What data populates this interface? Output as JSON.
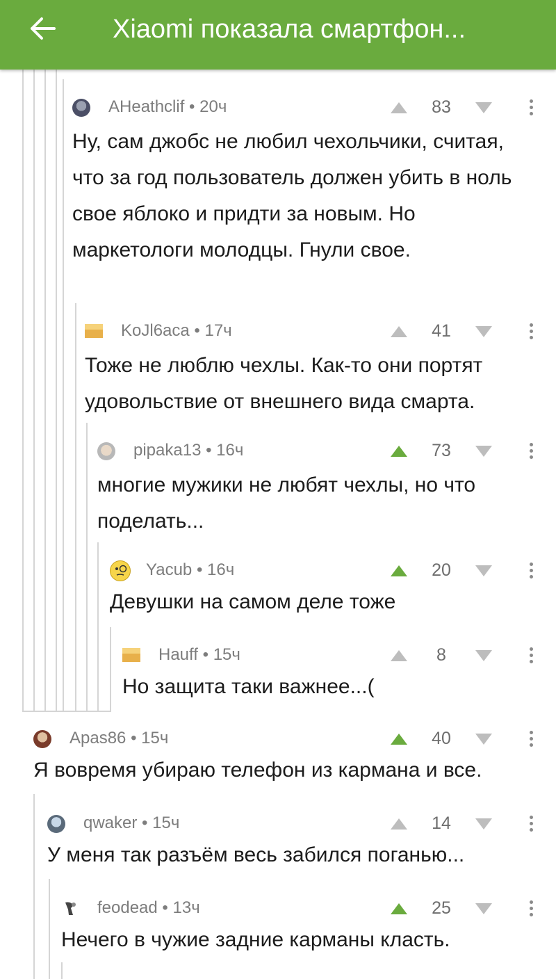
{
  "header": {
    "title": "Xiaomi показала смартфон...",
    "back_icon": "arrow-left-icon",
    "background_color": "#6aab3e"
  },
  "comments": [
    {
      "author": "AHeathclif",
      "time": "20ч",
      "rating": "83",
      "upvoted": false,
      "avatar": "avatar-photo",
      "text": "Ну, сам джобс не любил чехольчики, считая, что за год пользователь должен убить в ноль свое яблоко и придти за новым. Но маркетологи молодцы. Гнули свое."
    },
    {
      "author": "KoJl6aca",
      "time": "17ч",
      "rating": "41",
      "upvoted": false,
      "avatar": "default-avatar",
      "text": "Тоже не люблю чехлы. Как-то они портят удовольствие от внешнего вида смарта."
    },
    {
      "author": "pipaka13",
      "time": "16ч",
      "rating": "73",
      "upvoted": true,
      "avatar": "avatar-photo",
      "text": "многие мужики не любят чехлы, но что поделать..."
    },
    {
      "author": "Yacub",
      "time": "16ч",
      "rating": "20",
      "upvoted": true,
      "avatar": "monocle-smiley-avatar",
      "text": "Девушки на самом деле тоже"
    },
    {
      "author": "Hauff",
      "time": "15ч",
      "rating": "8",
      "upvoted": false,
      "avatar": "default-avatar",
      "text": "Но защита таки важнее...("
    },
    {
      "author": "Apas86",
      "time": "15ч",
      "rating": "40",
      "upvoted": true,
      "avatar": "avatar-photo",
      "text": "Я вовремя убираю телефон из кармана и все."
    },
    {
      "author": "qwaker",
      "time": "15ч",
      "rating": "14",
      "upvoted": false,
      "avatar": "avatar-photo",
      "text": "У меня так разъём весь забился поганью..."
    },
    {
      "author": "feodead",
      "time": "13ч",
      "rating": "25",
      "upvoted": true,
      "avatar": "avatar-photo",
      "text": "Нечего в чужие задние карманы класть."
    }
  ],
  "colors": {
    "vote_active": "#6aab3e",
    "vote_inactive": "#bdbdbd",
    "thread_line": "#d5d5d5"
  }
}
